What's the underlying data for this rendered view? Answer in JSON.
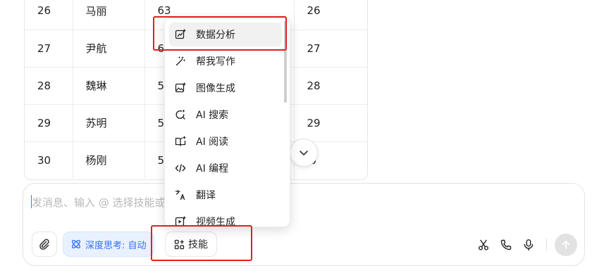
{
  "table": {
    "rows": [
      {
        "id": "26",
        "name": "马丽",
        "score": "63",
        "extra": "26"
      },
      {
        "id": "27",
        "name": "尹航",
        "score": "6",
        "extra": "27"
      },
      {
        "id": "28",
        "name": "魏琳",
        "score": "5",
        "extra": "28"
      },
      {
        "id": "29",
        "name": "苏明",
        "score": "5",
        "extra": "29"
      },
      {
        "id": "30",
        "name": "杨刚",
        "score": "5",
        "extra": "0"
      }
    ]
  },
  "menu": {
    "items": [
      {
        "label": "数据分析",
        "icon": "data-analysis-icon"
      },
      {
        "label": "帮我写作",
        "icon": "writing-wand-icon"
      },
      {
        "label": "图像生成",
        "icon": "image-gen-icon"
      },
      {
        "label": "AI 搜索",
        "icon": "ai-search-icon"
      },
      {
        "label": "AI 阅读",
        "icon": "ai-read-icon"
      },
      {
        "label": "AI 编程",
        "icon": "ai-code-icon"
      },
      {
        "label": "翻译",
        "icon": "translate-icon"
      },
      {
        "label": "视频生成",
        "icon": "video-gen-icon"
      }
    ]
  },
  "composer": {
    "placeholder": "发消息、输入 @ 选择技能或",
    "think_label": "深度思考: 自动",
    "skill_label": "技能"
  },
  "colors": {
    "accent": "#3370ff",
    "annotation": "#e02020"
  }
}
